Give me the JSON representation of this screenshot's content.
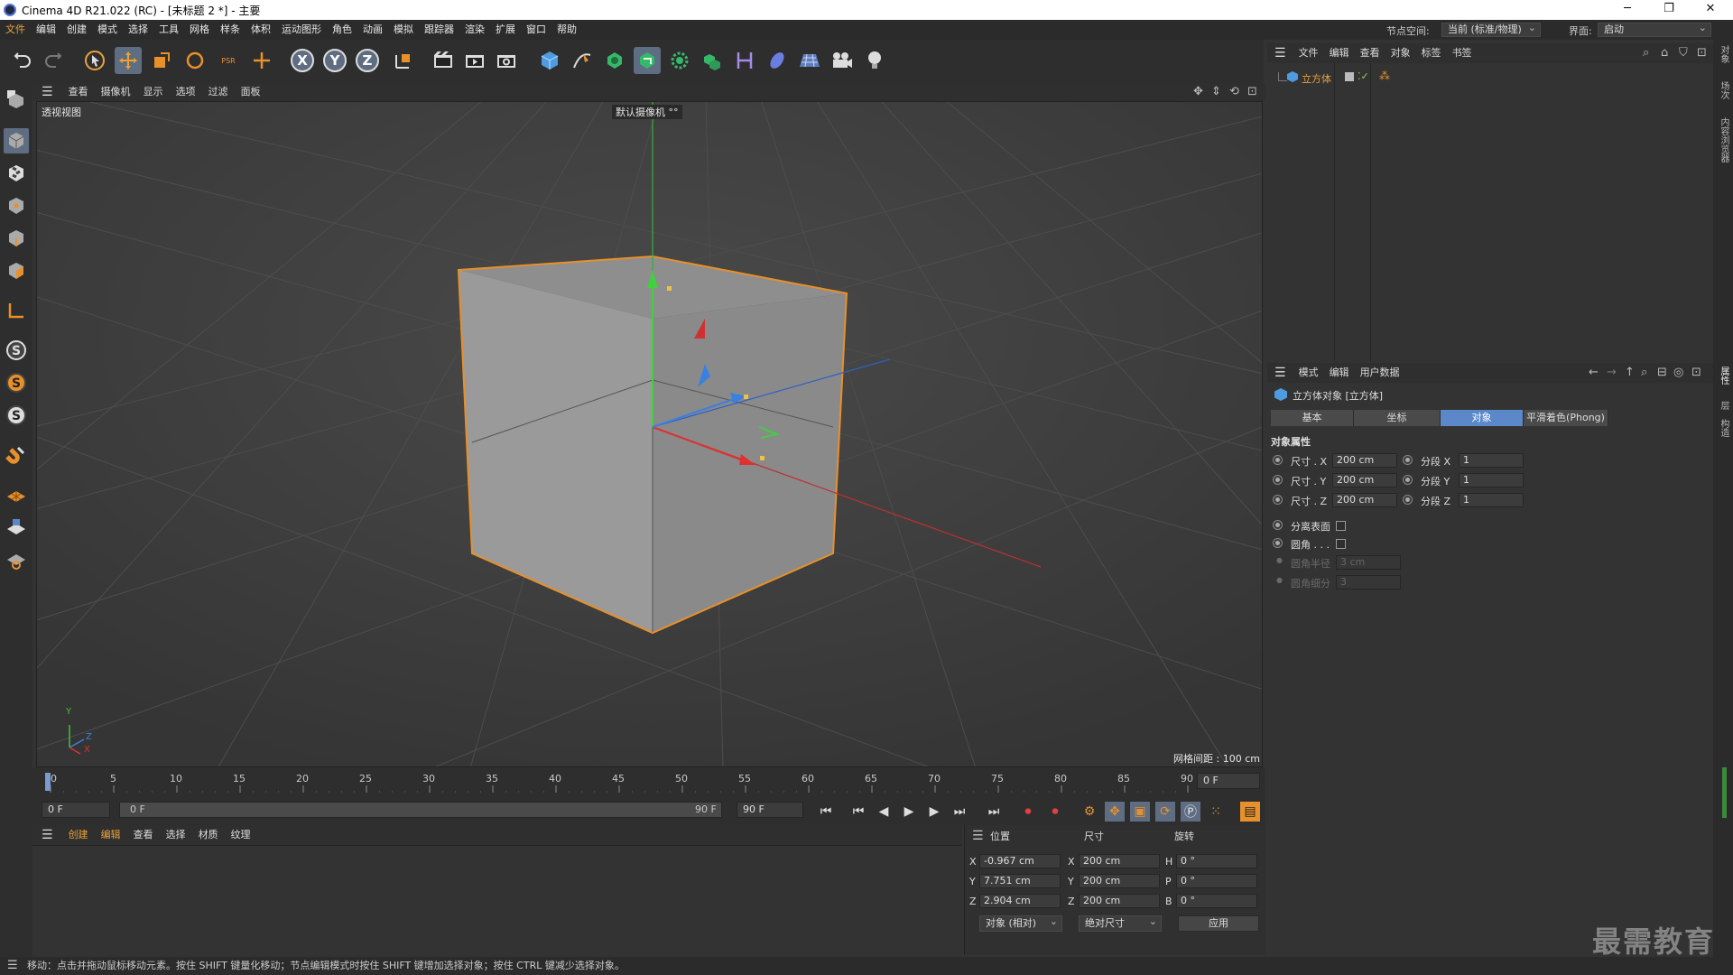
{
  "window": {
    "title": "Cinema 4D R21.022 (RC) - [未标题 2 *] - 主要",
    "min": "─",
    "max": "❐",
    "close": "✕"
  },
  "menubar": {
    "items": [
      "文件",
      "编辑",
      "创建",
      "模式",
      "选择",
      "工具",
      "网格",
      "样条",
      "体积",
      "运动图形",
      "角色",
      "动画",
      "模拟",
      "跟踪器",
      "渲染",
      "扩展",
      "窗口",
      "帮助"
    ],
    "node_space_label": "节点空间:",
    "node_space_value": "当前 (标准/物理)",
    "layout_label": "界面:",
    "layout_value": "启动"
  },
  "toolbar": {
    "axis_x": "X",
    "axis_y": "Y",
    "axis_z": "Z",
    "psr": "PSR"
  },
  "viewport": {
    "menu": [
      "查看",
      "摄像机",
      "显示",
      "选项",
      "过滤",
      "面板"
    ],
    "view_name": "透视视图",
    "camera": "默认摄像机 °°",
    "grid_spacing": "网格间距 : 100 cm",
    "axis_labels": {
      "y": "Y",
      "z": "Z",
      "x": "X"
    }
  },
  "timeline": {
    "ticks": [
      "0",
      "5",
      "10",
      "15",
      "20",
      "25",
      "30",
      "35",
      "40",
      "45",
      "50",
      "55",
      "60",
      "65",
      "70",
      "75",
      "80",
      "85",
      "90"
    ],
    "current_frame": "0 F",
    "start_field": "0 F",
    "range_start": "0 F",
    "range_end": "90 F",
    "end_field": "90 F"
  },
  "material_manager": {
    "menu": [
      "创建",
      "编辑",
      "查看",
      "选择",
      "材质",
      "纹理"
    ]
  },
  "coordinates": {
    "headers": {
      "position": "位置",
      "size": "尺寸",
      "rotation": "旋转"
    },
    "rows": [
      {
        "axis": "X",
        "pos": "-0.967 cm",
        "size_axis": "X",
        "size": "200 cm",
        "rot_axis": "H",
        "rot": "0 °"
      },
      {
        "axis": "Y",
        "pos": "7.751 cm",
        "size_axis": "Y",
        "size": "200 cm",
        "rot_axis": "P",
        "rot": "0 °"
      },
      {
        "axis": "Z",
        "pos": "2.904 cm",
        "size_axis": "Z",
        "size": "200 cm",
        "rot_axis": "B",
        "rot": "0 °"
      }
    ],
    "mode": "对象 (相对)",
    "size_mode": "绝对尺寸",
    "apply": "应用"
  },
  "object_manager": {
    "menu": [
      "文件",
      "编辑",
      "查看",
      "对象",
      "标签",
      "书签"
    ],
    "objects": [
      {
        "name": "立方体"
      }
    ]
  },
  "attribute_manager": {
    "menu": [
      "模式",
      "编辑",
      "用户数据"
    ],
    "header": "立方体对象 [立方体]",
    "tabs": [
      "基本",
      "坐标",
      "对象",
      "平滑着色(Phong)"
    ],
    "active_tab": "对象",
    "section": "对象属性",
    "size_x_label": "尺寸 . X",
    "size_x": "200 cm",
    "size_y_label": "尺寸 . Y",
    "size_y": "200 cm",
    "size_z_label": "尺寸 . Z",
    "size_z": "200 cm",
    "seg_x_label": "分段 X",
    "seg_x": "1",
    "seg_y_label": "分段 Y",
    "seg_y": "1",
    "seg_z_label": "分段 Z",
    "seg_z": "1",
    "separate_label": "分离表面",
    "fillet_label": "圆角 . . .",
    "fillet_radius_label": "圆角半径",
    "fillet_radius": "3 cm",
    "fillet_sub_label": "圆角细分",
    "fillet_sub": "3"
  },
  "right_dock": [
    "对象",
    "场次",
    "内容浏览器",
    "属性",
    "层",
    "构造"
  ],
  "status": "移动：点击并拖动鼠标移动元素。按住 SHIFT 键量化移动；节点编辑模式时按住 SHIFT 键增加选择对象；按住 CTRL 键减少选择对象。",
  "watermark": "最需教育",
  "colors": {
    "accent": "#5b88c9",
    "selection": "#e8a33b",
    "x_axis": "#d03030",
    "y_axis": "#30c030",
    "z_axis": "#3070d0"
  }
}
